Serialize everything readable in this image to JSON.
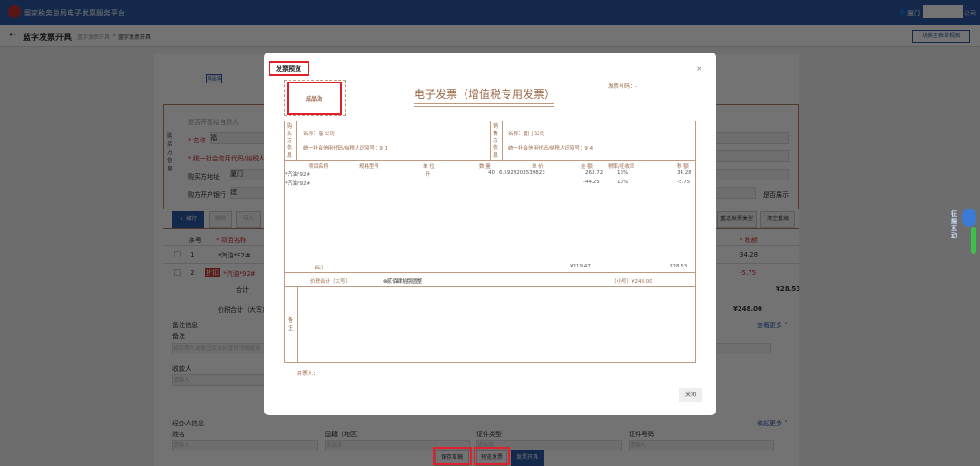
{
  "header": {
    "title": "国家税务总局电子发票服务平台",
    "user_prefix": "厦门",
    "user_suffix": "公司"
  },
  "crumb": {
    "back": "←",
    "page_title": "蓝字发票开具",
    "path1": "蓝字发票开具",
    "sep": ">",
    "path2": "蓝字发票开具",
    "switch_btn": "切换至表单视图"
  },
  "form": {
    "tag": "成品油",
    "buyer_side": "购买方信息",
    "natural_person": "是否开票给自然人",
    "name_label": "* 名称",
    "name_val": "福",
    "credit_label": "* 统一社会信用代码/纳税人识别号",
    "addr_label": "购买方地址",
    "addr_val": "厦门",
    "bank_label": "购方开户银行",
    "bank_val": "建",
    "show_label": "是否展示",
    "add_row": "+ 增行",
    "delete": "删除",
    "import": "导入",
    "item_type": "重选发票类型",
    "clear": "清空重填",
    "col_no": "序号",
    "col_name": "* 项目名称",
    "col_tax": "* 税额",
    "rows": [
      {
        "no": "1",
        "name": "*汽油*92#",
        "tax": "34.28",
        "tag": ""
      },
      {
        "no": "2",
        "name": "*汽油*92#",
        "tax": "-5.75",
        "tag": "折扣"
      }
    ],
    "total_label": "合计",
    "total_tax": "¥28.53",
    "grand_label": "价税合计（大写）",
    "grand_val": "¥248.00",
    "remark_section": "备注信息",
    "remark_label": "备注",
    "remark_ph": "如开票人对备注文本长度有特殊需求",
    "payee_label": "收款人",
    "payee_ph": "请输入",
    "more": "查看更多 ˅",
    "handler_section": "经办人信息",
    "collapse": "收起更多 ˄",
    "h_name": "姓名",
    "h_name_ph": "请输入",
    "h_country": "国籍（地区）",
    "h_country_ph": "请选择",
    "h_idtype": "证件类型",
    "h_idtype_ph": "请选择",
    "h_idno": "证件号码",
    "h_idno_ph": "请输入"
  },
  "bottom": {
    "save": "保存草稿",
    "preview": "预览发票",
    "issue": "发票开具"
  },
  "widget": {
    "label": "征纳互动"
  },
  "modal": {
    "title": "发票预览",
    "close_x": "×",
    "seal": "成品油",
    "invoice_title": "电子发票（增值税专用发票）",
    "invoice_no_label": "发票号码：-",
    "buyer_side": "购买方信息",
    "seller_side": "销售方信息",
    "buyer_name": "名称：福                        公司",
    "buyer_id": "统一社会信用代码/纳税人识别号：9                    1",
    "seller_name": "名称：厦门                        公司",
    "seller_id": "统一社会信用代码/纳税人识别号：9                    4",
    "cols": [
      "项目名称",
      "规格型号",
      "单 位",
      "数 量",
      "单 价",
      "金 额",
      "税率/征收率",
      "税 额"
    ],
    "items": [
      {
        "name": "*汽油*92#",
        "spec": "",
        "unit": "升",
        "qty": "40",
        "price": "6.5929203539823",
        "amount": "263.72",
        "rate": "13%",
        "tax": "34.28"
      },
      {
        "name": "*汽油*92#",
        "spec": "",
        "unit": "",
        "qty": "",
        "price": "",
        "amount": "-44.25",
        "rate": "13%",
        "tax": "-5.75"
      }
    ],
    "sum_label": "合计",
    "sum_amount": "¥219.47",
    "sum_tax": "¥28.53",
    "grand_label": "价税合计（大写）",
    "grand_upper": "⊗贰佰肆拾捌圆整",
    "grand_lower": "（小写）¥248.00",
    "remark_label": "备注",
    "drawer_label": "开票人：",
    "close_btn": "关闭"
  }
}
